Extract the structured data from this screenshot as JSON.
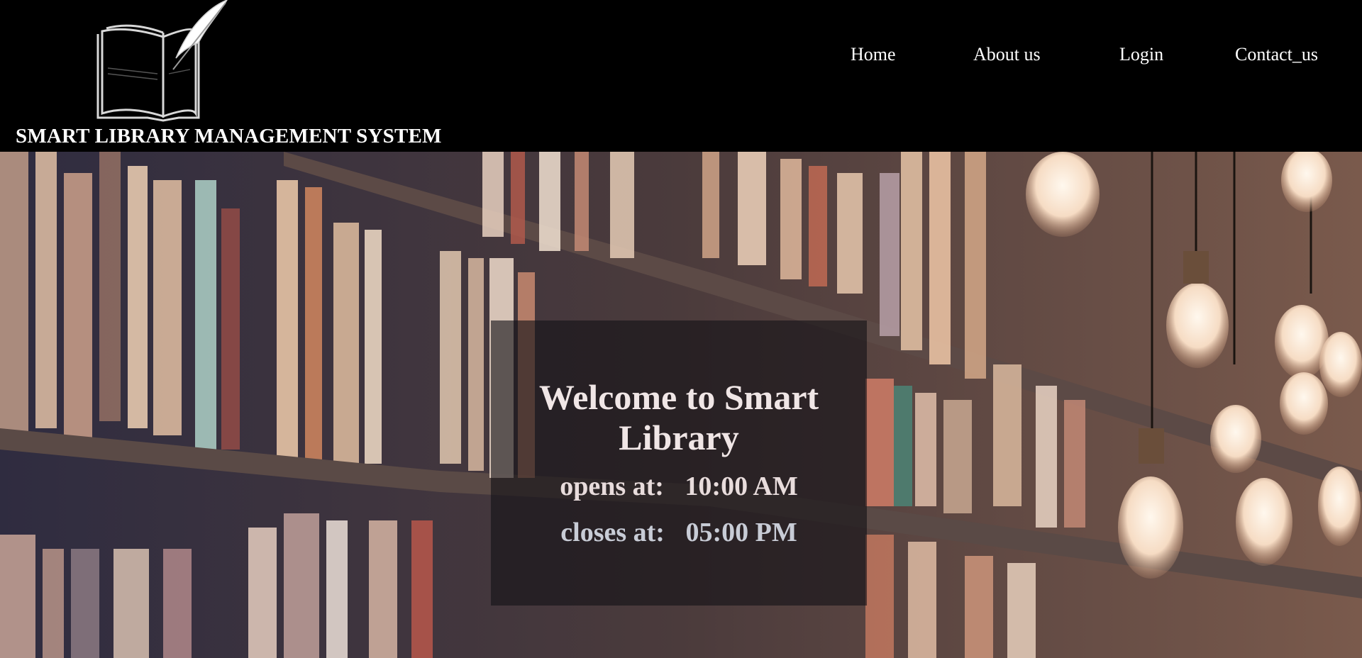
{
  "header": {
    "site_title": "SMART LIBRARY MANAGEMENT SYSTEM",
    "logo_icon": "open-book-quill-icon",
    "nav": [
      {
        "label": "Home"
      },
      {
        "label": "About us"
      },
      {
        "label": "Login"
      },
      {
        "label": "Contact_us"
      }
    ]
  },
  "hero": {
    "background": "library-bookshelves-with-hanging-bulbs",
    "welcome_title": "Welcome to Smart Library",
    "opens_label": "opens at:",
    "opens_time": "10:00 AM",
    "closes_label": "closes at:",
    "closes_time": "05:00 PM"
  },
  "colors": {
    "header_bg": "#000000",
    "text": "#ffffff",
    "overlay": "#141216"
  }
}
